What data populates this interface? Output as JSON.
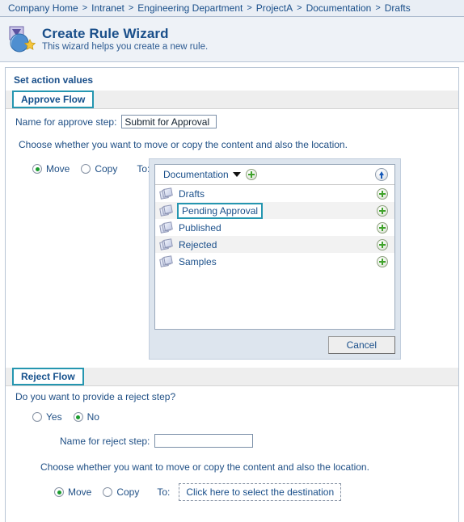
{
  "breadcrumb": {
    "separator": ">",
    "items": [
      "Company Home",
      "Intranet",
      "Engineering Department",
      "ProjectA",
      "Documentation",
      "Drafts"
    ]
  },
  "header": {
    "title": "Create Rule Wizard",
    "subtitle": "This wizard helps you create a new rule.",
    "icon": "wizard-star-icon"
  },
  "main": {
    "section_title": "Set action values"
  },
  "approve_flow": {
    "tab_label": "Approve Flow",
    "name_label": "Name for approve step:",
    "name_value": "Submit for Approval",
    "name_placeholder": "",
    "help_text": "Choose whether you want to move or copy the content and also the location.",
    "move_label": "Move",
    "copy_label": "Copy",
    "selected_action": "Move",
    "to_label": "To:"
  },
  "picker": {
    "current_folder": "Documentation",
    "add_icon": "green-plus-icon",
    "up_icon": "blue-up-arrow-icon",
    "caret_icon": "caret-down-icon",
    "folder_icon": "folder-icon",
    "cancel_label": "Cancel",
    "selected_item": "Pending Approval",
    "items": [
      {
        "name": "Drafts"
      },
      {
        "name": "Pending Approval"
      },
      {
        "name": "Published"
      },
      {
        "name": "Rejected"
      },
      {
        "name": "Samples"
      }
    ]
  },
  "reject_flow": {
    "tab_label": "Reject Flow",
    "question": "Do you want to provide a reject step?",
    "yes_label": "Yes",
    "no_label": "No",
    "selected_answer": "No",
    "name_label": "Name for reject step:",
    "name_value": "",
    "name_placeholder": "",
    "help_text": "Choose whether you want to move or copy the content and also the location.",
    "move_label": "Move",
    "copy_label": "Copy",
    "selected_action": "Move",
    "to_label": "To:",
    "destination_label": "Click here to select the destination"
  },
  "colors": {
    "accent_teal": "#2596b0",
    "link_blue": "#1a4f8a",
    "radio_green": "#1a9b2e",
    "panel_bg": "#dde5ee"
  }
}
